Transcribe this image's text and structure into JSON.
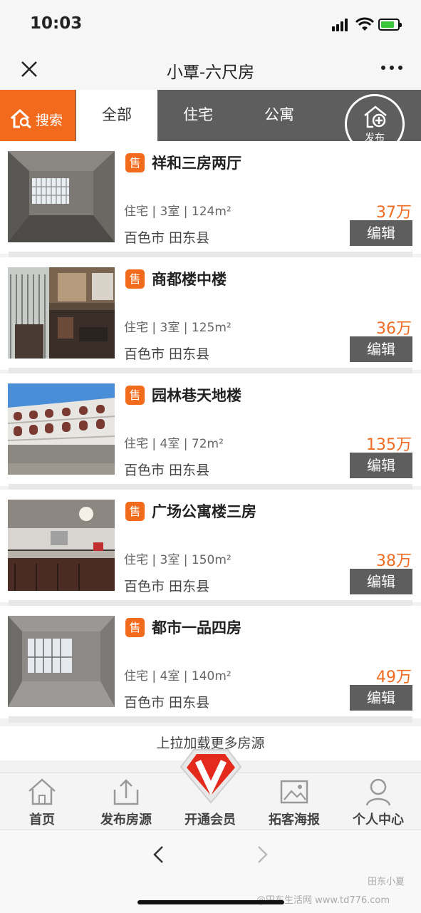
{
  "status": {
    "time": "10:03"
  },
  "nav": {
    "title": "小覃-六尺房"
  },
  "tabs": {
    "search": "搜索",
    "items": [
      "全部",
      "住宅",
      "公寓"
    ],
    "publish": "发布"
  },
  "listings": [
    {
      "badge": "售",
      "title": "祥和三房两厅",
      "spec": "住宅 | 3室 | 124m²",
      "price": "37万",
      "location": "百色市 田东县",
      "edit": "编辑"
    },
    {
      "badge": "售",
      "title": "商都楼中楼",
      "spec": "住宅 | 3室 | 125m²",
      "price": "36万",
      "location": "百色市 田东县",
      "edit": "编辑"
    },
    {
      "badge": "售",
      "title": "园林巷天地楼",
      "spec": "住宅 | 4室 | 72m²",
      "price": "135万",
      "location": "百色市 田东县",
      "edit": "编辑"
    },
    {
      "badge": "售",
      "title": "广场公寓楼三房",
      "spec": "住宅 | 3室 | 150m²",
      "price": "38万",
      "location": "百色市 田东县",
      "edit": "编辑"
    },
    {
      "badge": "售",
      "title": "都市一品四房",
      "spec": "住宅 | 4室 | 140m²",
      "price": "49万",
      "location": "百色市 田东县",
      "edit": "编辑"
    }
  ],
  "load_more": "上拉加载更多房源",
  "tabbar": {
    "home": "首页",
    "publish": "发布房源",
    "vip": "开通会员",
    "poster": "拓客海报",
    "profile": "个人中心"
  },
  "watermark": {
    "line1": "田东小夏",
    "line2": "@田东生活网 www.td776.com"
  },
  "colors": {
    "accent": "#f26b1d",
    "dark": "#5e5e5e",
    "price": "#ef6b22"
  }
}
